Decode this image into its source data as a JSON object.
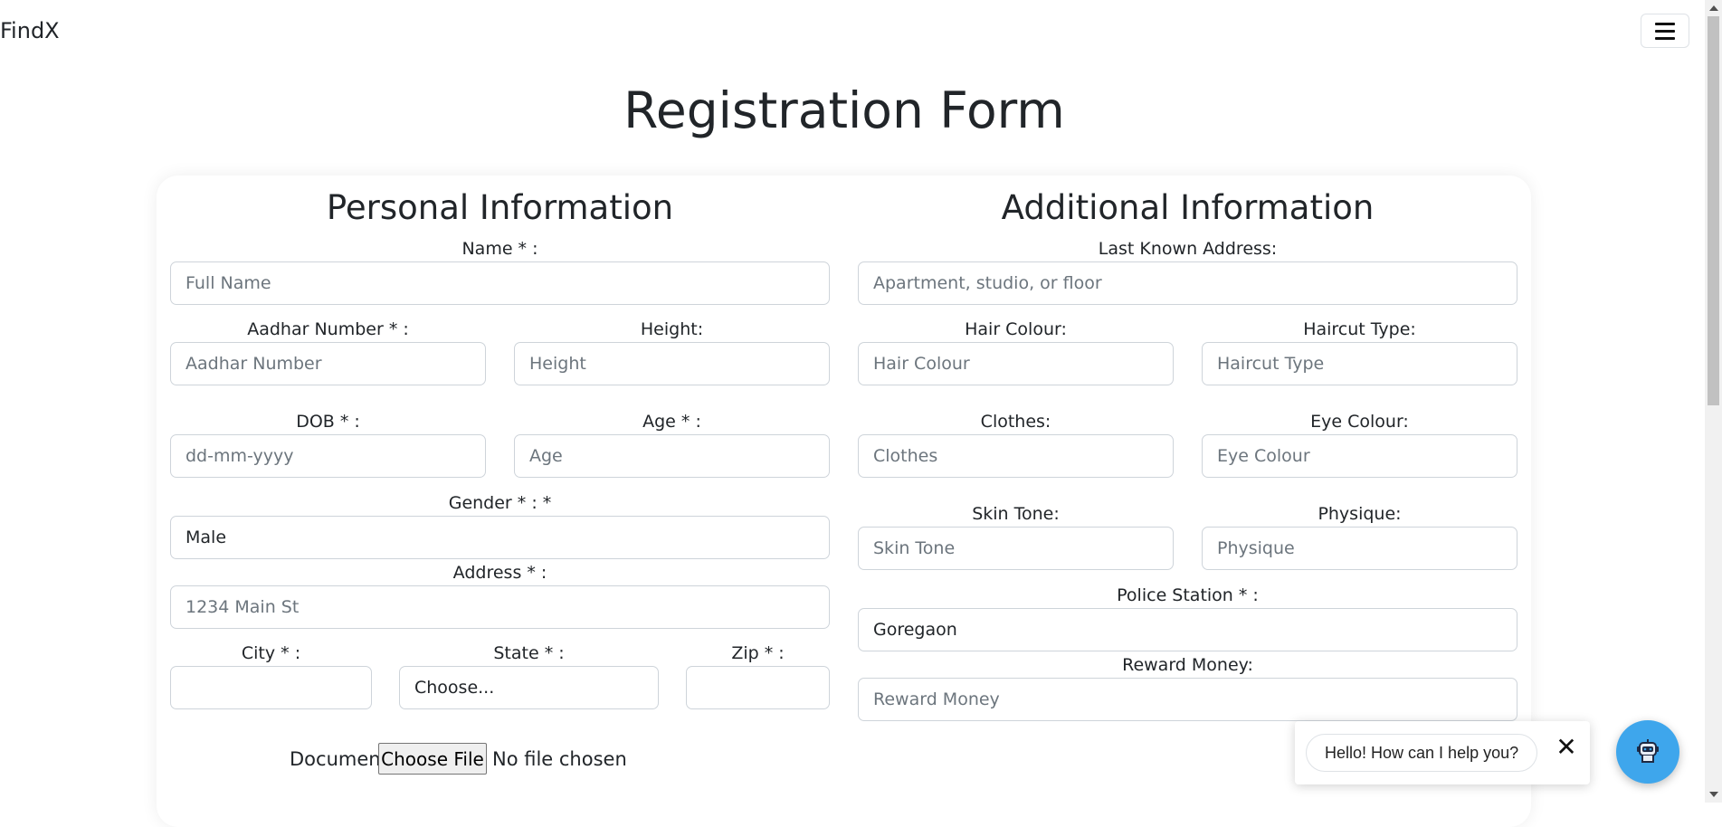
{
  "navbar": {
    "brand": "FindX",
    "menu_icon": "hamburger-icon"
  },
  "page": {
    "title": "Registration Form"
  },
  "personal": {
    "title": "Personal Information",
    "name": {
      "label": "Name * :",
      "placeholder": "Full Name"
    },
    "aadhar": {
      "label": "Aadhar Number * :",
      "placeholder": "Aadhar Number"
    },
    "height": {
      "label": "Height:",
      "placeholder": "Height"
    },
    "dob": {
      "label": "DOB * :",
      "placeholder": "dd-mm-yyyy"
    },
    "age": {
      "label": "Age * :",
      "placeholder": "Age"
    },
    "gender": {
      "label": "Gender * : *",
      "value": "Male"
    },
    "address": {
      "label": "Address * :",
      "placeholder": "1234 Main St"
    },
    "city": {
      "label": "City * :",
      "placeholder": ""
    },
    "state": {
      "label": "State * :",
      "value": "Choose..."
    },
    "zip": {
      "label": "Zip * :",
      "placeholder": ""
    },
    "document": {
      "label": "Document",
      "button": "Choose File",
      "status": "No file chosen"
    }
  },
  "additional": {
    "title": "Additional Information",
    "last_address": {
      "label": "Last Known Address:",
      "placeholder": "Apartment, studio, or floor"
    },
    "hair_colour": {
      "label": "Hair Colour:",
      "placeholder": "Hair Colour"
    },
    "haircut": {
      "label": "Haircut Type:",
      "placeholder": "Haircut Type"
    },
    "clothes": {
      "label": "Clothes:",
      "placeholder": "Clothes"
    },
    "eye_colour": {
      "label": "Eye Colour:",
      "placeholder": "Eye Colour"
    },
    "skin_tone": {
      "label": "Skin Tone:",
      "placeholder": "Skin Tone"
    },
    "physique": {
      "label": "Physique:",
      "placeholder": "Physique"
    },
    "police_station": {
      "label": "Police Station * :",
      "value": "Goregaon"
    },
    "reward": {
      "label": "Reward Money:",
      "placeholder": "Reward Money"
    }
  },
  "chat": {
    "message": "Hello! How can I help you?",
    "close": "✕",
    "bot_icon": "robot-icon",
    "fab_color": "#3ea6ec"
  }
}
